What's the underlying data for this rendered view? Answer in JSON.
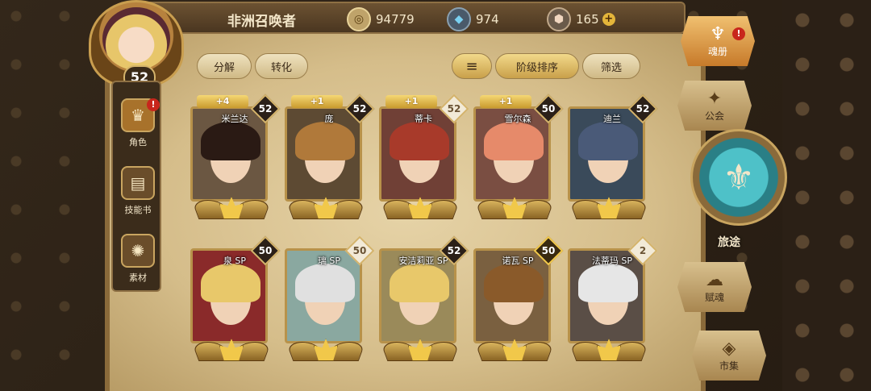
{
  "header": {
    "player_name": "非洲召唤者",
    "level": "52",
    "gold": "94779",
    "crystal": "974",
    "stone": "165",
    "plus": "+"
  },
  "side_menu": [
    {
      "label": "角色",
      "icon": "character-icon",
      "alert": "!"
    },
    {
      "label": "技能书",
      "icon": "skillbook-icon"
    },
    {
      "label": "素材",
      "icon": "materials-icon"
    }
  ],
  "toolbar": {
    "decompose": "分解",
    "convert": "转化",
    "sort_icon": "≡",
    "sort_by": "阶级排序",
    "filter": "筛选"
  },
  "cards_row1": [
    {
      "name": "米兰达",
      "level": "52",
      "star": "+4",
      "hair": "#2a1a14",
      "bg": "#6b5742",
      "level_style": "dark"
    },
    {
      "name": "庞",
      "level": "52",
      "star": "+1",
      "hair": "#b0793a",
      "bg": "#5d4a33",
      "level_style": "dark"
    },
    {
      "name": "蒂卡",
      "level": "52",
      "star": "+1",
      "hair": "#a83a2a",
      "bg": "#704036",
      "level_style": "light"
    },
    {
      "name": "雪尔森",
      "level": "50",
      "star": "+1",
      "hair": "#e68a6a",
      "bg": "#7a4e42",
      "level_style": "dark"
    },
    {
      "name": "迪兰",
      "level": "52",
      "star": "",
      "hair": "#4a5a78",
      "bg": "#3a4a5a",
      "level_style": "dark"
    }
  ],
  "cards_row2": [
    {
      "name": "泉 SP",
      "level": "50",
      "star": "",
      "hair": "#e8c86a",
      "bg": "#8a2a2a",
      "level_style": "dark"
    },
    {
      "name": "璃 SP",
      "level": "50",
      "star": "",
      "hair": "#e0e0e0",
      "bg": "#8aa8a0",
      "level_style": "light"
    },
    {
      "name": "安洁莉亚 SP",
      "level": "52",
      "star": "",
      "hair": "#e8c86a",
      "bg": "#9a8a5a",
      "level_style": "dark"
    },
    {
      "name": "诺瓦 SP",
      "level": "50",
      "star": "",
      "hair": "#8a5a2a",
      "bg": "#7a6040",
      "level_style": "gold"
    },
    {
      "name": "法蒂玛 SP",
      "level": "2",
      "star": "",
      "hair": "#e6e6e6",
      "bg": "#5a4e46",
      "level_style": "light"
    }
  ],
  "right_nav": {
    "soul_book": "魂册",
    "guild": "公会",
    "journey": "旅途",
    "talent": "赋魂",
    "market": "市集",
    "alert": "!"
  }
}
